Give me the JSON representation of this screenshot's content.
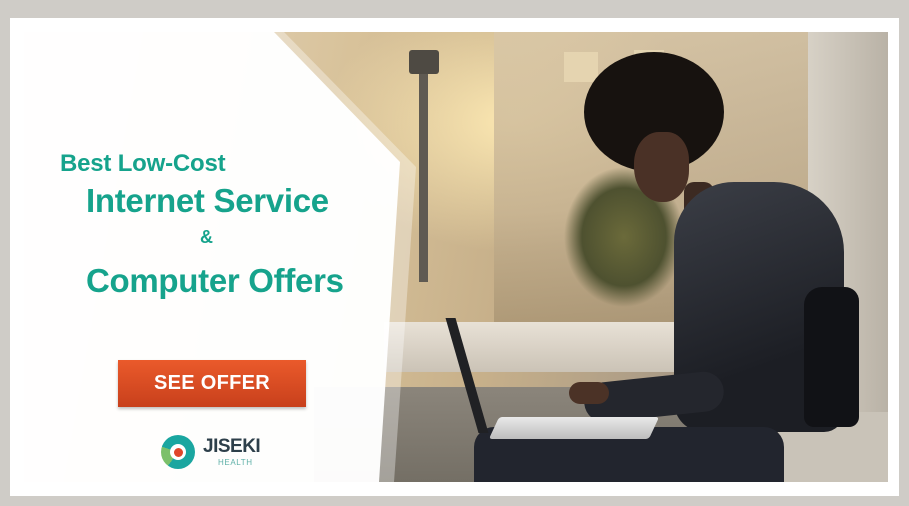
{
  "ad": {
    "headline_line1": "Best Low-Cost",
    "headline_line2": "Internet Service",
    "headline_amp": "&",
    "headline_line3": "Computer Offers",
    "cta_label": "SEE OFFER"
  },
  "brand": {
    "name": "JISEKI",
    "subname": "HEALTH"
  },
  "colors": {
    "headline": "#16a38c",
    "cta": "#d9482a",
    "logo_teal": "#1aa6a0",
    "logo_red": "#e0462a"
  }
}
